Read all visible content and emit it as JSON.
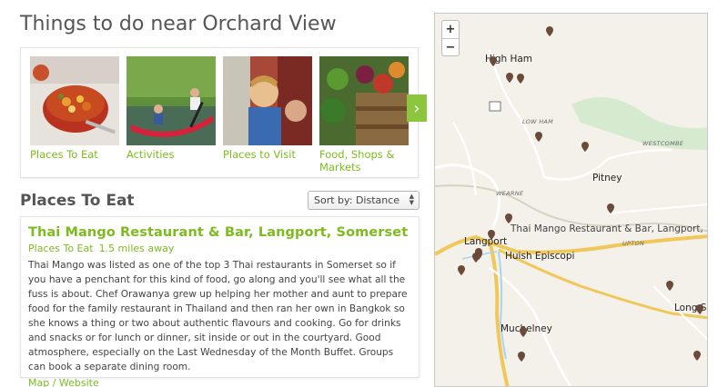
{
  "page": {
    "title": "Things to do near Orchard View"
  },
  "categories": [
    {
      "label": "Places To Eat"
    },
    {
      "label": "Activities"
    },
    {
      "label": "Places to Visit"
    },
    {
      "label": "Food, Shops & Markets"
    }
  ],
  "section": {
    "title": "Places To Eat"
  },
  "sort": {
    "selected": "Sort by: Distance"
  },
  "result": {
    "title": "Thai Mango Restaurant & Bar, Langport, Somerset",
    "category": "Places To Eat",
    "distance": "1.5 miles away",
    "description": "Thai Mango was listed as one of the top 3 Thai restaurants in Somerset so if you have a penchant for this kind of food, go along and you'll see what all the fuss is about. Chef Orawanya grew up helping her mother and aunt to prepare food for the family restaurant in Thailand and then ran her own in Bangkok so she knows a thing or two about authentic flavours and cooking. Go for drinks and snacks or for lunch or dinner, sit inside or out in the courtyard. Good atmosphere, especially on the Last Wednesday of the Month Buffet. Groups can book a separate dining room.",
    "links": "Map / Website"
  },
  "map": {
    "zoom_in": "+",
    "zoom_out": "−",
    "labels": {
      "high_ham": "High Ham",
      "low_ham": "LOW HAM",
      "westcombe": "WESTCOMBE",
      "pitney": "Pitney",
      "wearne": "WEARNE",
      "langport": "Langport",
      "popup": "Thai Mango Restaurant & Bar, Langport, So",
      "upton": "UPTON",
      "huish": "Huish Episcopi",
      "long": "Long Su",
      "muchelney": "Muchelney"
    },
    "colors": {
      "road_major": "#f7d57a",
      "road_minor": "#ffffff",
      "river": "#a8d4f0",
      "green": "#c9e6b0",
      "pin": "#6b4a3a"
    }
  },
  "colors": {
    "accent": "#7dbb1f",
    "arrow": "#8cc63f"
  }
}
